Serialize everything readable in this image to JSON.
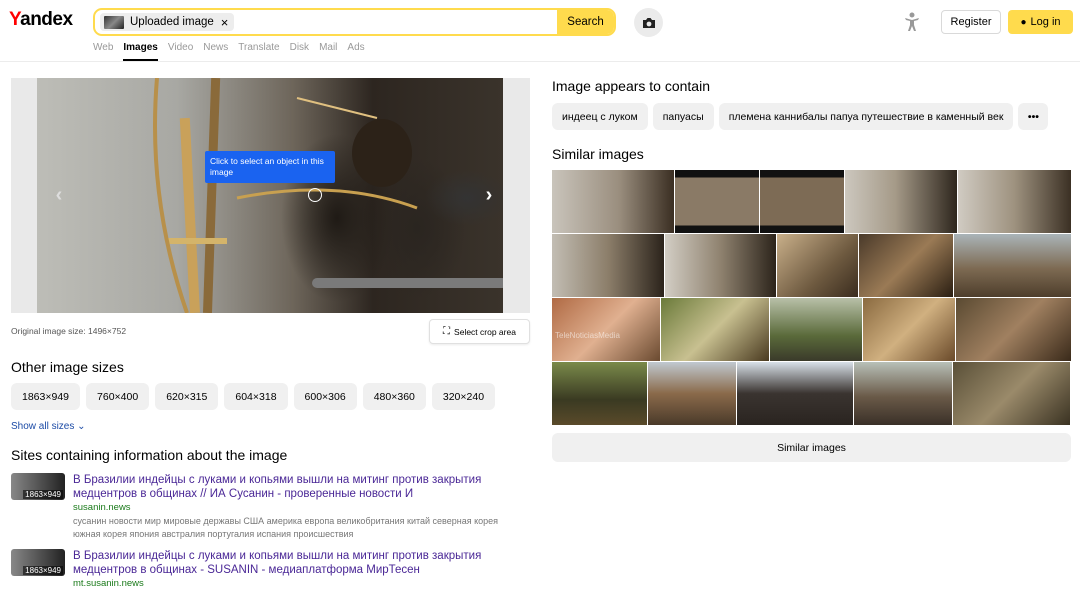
{
  "header": {
    "logo": "Yandex",
    "search_chip": "Uploaded image",
    "search_button": "Search",
    "register": "Register",
    "login": "Log in",
    "nav": [
      "Web",
      "Images",
      "Video",
      "News",
      "Translate",
      "Disk",
      "Mail",
      "Ads"
    ],
    "active_nav": "Images"
  },
  "main_image": {
    "tooltip": "Click to select an object in this image",
    "original_size": "Original image size: 1496×752",
    "crop_button": "Select crop area"
  },
  "other_sizes": {
    "title": "Other image sizes",
    "sizes": [
      "1863×949",
      "760×400",
      "620×315",
      "604×318",
      "600×306",
      "480×360",
      "320×240"
    ],
    "show_all": "Show all sizes"
  },
  "sites": {
    "title": "Sites containing information about the image",
    "items": [
      {
        "thumb_size": "1863×949",
        "title": "В Бразилии индейцы с луками и копьями вышли на митинг против закрытия медцентров в общинах // ИА Сусанин - проверенные новости И",
        "url": "susanin.news",
        "desc": "сусанин новости мир мировые державы США америка европа великобритания китай северная корея южная корея япония австралия португалия испания происшествия"
      },
      {
        "thumb_size": "1863×949",
        "title": "В Бразилии индейцы с луками и копьями вышли на митинг против закрытия медцентров в общинах - SUSANIN - медиаплатформа МирТесен",
        "url": "mt.susanin.news",
        "desc": ""
      }
    ]
  },
  "contains": {
    "title": "Image appears to contain",
    "tags": [
      "индеец с луком",
      "папуасы",
      "племена каннибалы папуа путешествие в каменный век"
    ],
    "more": "•••"
  },
  "similar": {
    "title": "Similar images",
    "button": "Similar images",
    "watermark": "TeleNoticiasMedia"
  }
}
